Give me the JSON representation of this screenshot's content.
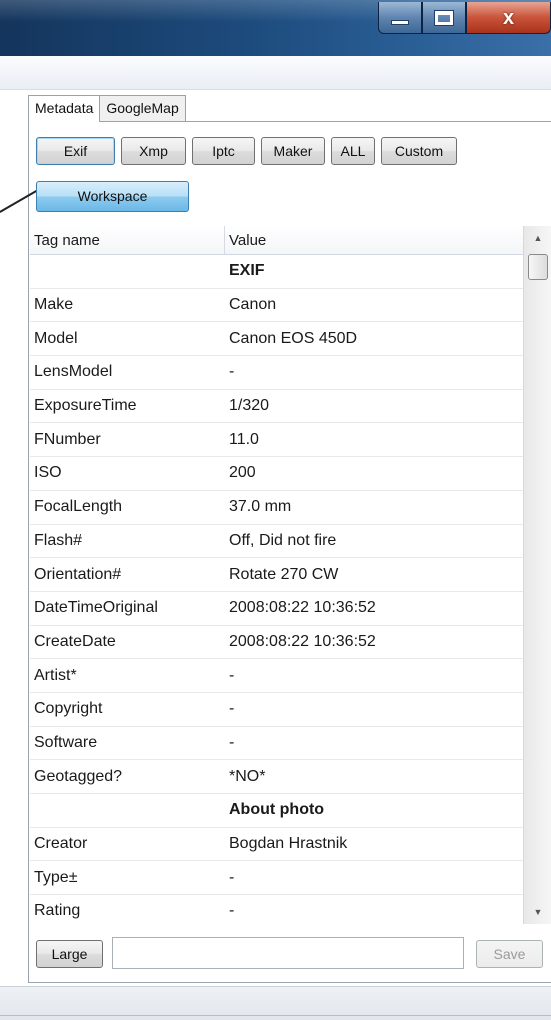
{
  "window": {
    "minimize_label": "minimize",
    "maximize_label": "maximize",
    "close_glyph": "x"
  },
  "tabs": [
    {
      "label": "Metadata",
      "active": true
    },
    {
      "label": "GoogleMap",
      "active": false
    }
  ],
  "toolbar": {
    "buttons": [
      "Exif",
      "Xmp",
      "Iptc",
      "Maker",
      "ALL",
      "Custom"
    ],
    "workspace_label": "Workspace"
  },
  "grid": {
    "headers": [
      "Tag name",
      "Value"
    ],
    "rows": [
      {
        "tag": "",
        "value": "EXIF",
        "section": true
      },
      {
        "tag": "Make",
        "value": "Canon"
      },
      {
        "tag": "Model",
        "value": "Canon EOS 450D"
      },
      {
        "tag": "LensModel",
        "value": "-"
      },
      {
        "tag": "ExposureTime",
        "value": "1/320"
      },
      {
        "tag": "FNumber",
        "value": "11.0"
      },
      {
        "tag": "ISO",
        "value": "200"
      },
      {
        "tag": "FocalLength",
        "value": "37.0 mm"
      },
      {
        "tag": "Flash#",
        "value": "Off, Did not fire"
      },
      {
        "tag": "Orientation#",
        "value": "Rotate 270 CW"
      },
      {
        "tag": "DateTimeOriginal",
        "value": "2008:08:22 10:36:52"
      },
      {
        "tag": "CreateDate",
        "value": "2008:08:22 10:36:52"
      },
      {
        "tag": "Artist*",
        "value": "-"
      },
      {
        "tag": "Copyright",
        "value": "-"
      },
      {
        "tag": "Software",
        "value": "-"
      },
      {
        "tag": "Geotagged?",
        "value": "*NO*"
      },
      {
        "tag": "",
        "value": "About photo",
        "section": true
      },
      {
        "tag": "Creator",
        "value": "Bogdan Hrastnik"
      },
      {
        "tag": "Type±",
        "value": "-"
      },
      {
        "tag": "Rating",
        "value": "-"
      }
    ]
  },
  "bottom": {
    "large_label": "Large",
    "input_value": "",
    "save_label": "Save"
  },
  "icons": {
    "scroll_up": "scroll-up-arrow-icon",
    "scroll_down": "scroll-down-arrow-icon"
  },
  "colors": {
    "titlebar": "#1d4b7d",
    "close_button": "#c9543a",
    "workspace_button": "#8ecbef"
  }
}
